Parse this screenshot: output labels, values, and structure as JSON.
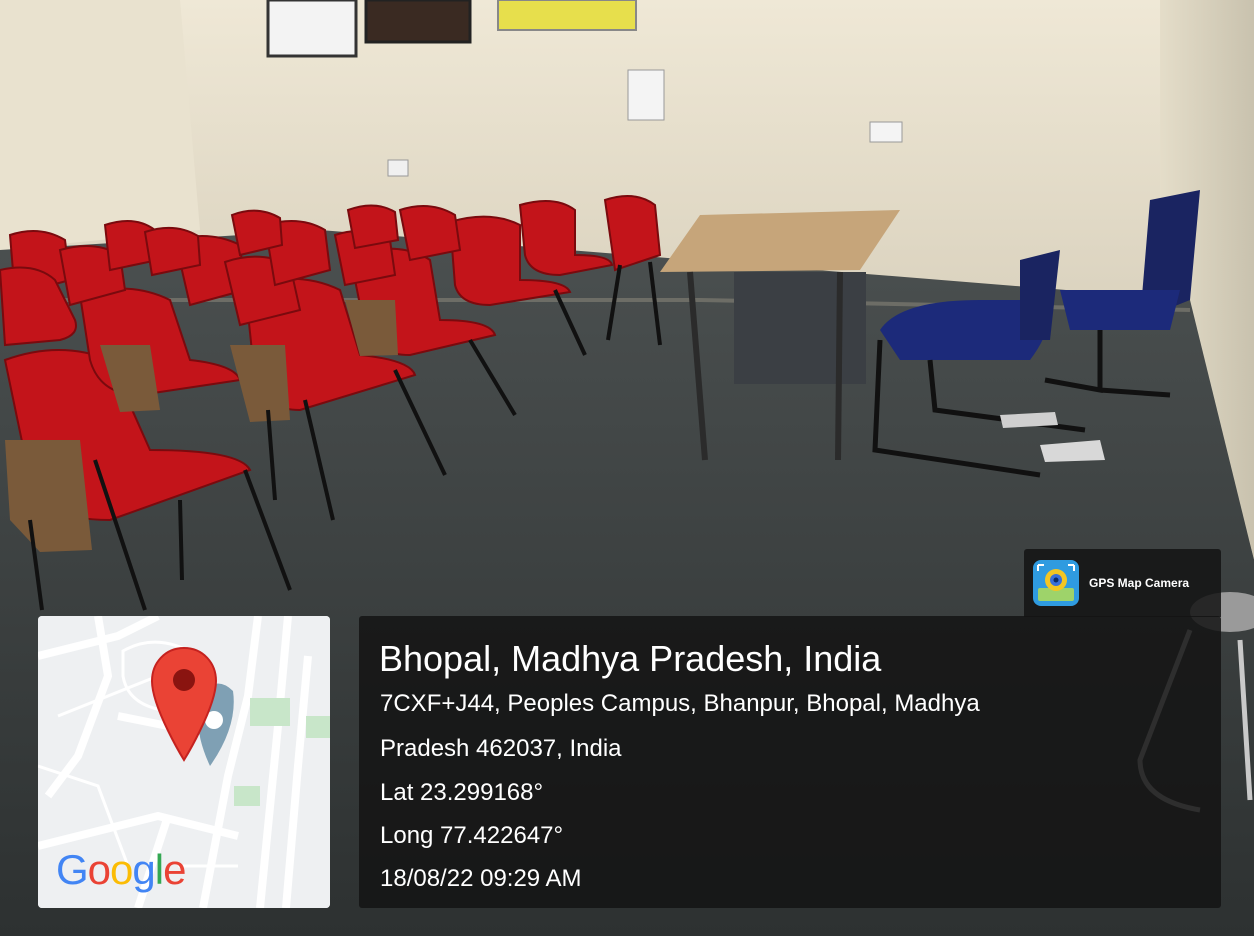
{
  "photo": {
    "description_icon": "classroom-photo"
  },
  "map": {
    "logo_text": [
      "G",
      "o",
      "o",
      "g",
      "l",
      "e"
    ],
    "logo_colors": [
      "#4285F4",
      "#EA4335",
      "#FBBC05",
      "#4285F4",
      "#34A853",
      "#EA4335"
    ],
    "pin_color": "#EA4335"
  },
  "badge": {
    "label": "GPS Map Camera",
    "icon": "gps-map-camera-icon"
  },
  "location": {
    "title": "Bhopal, Madhya Pradesh, India",
    "address_line1": "7CXF+J44, Peoples Campus, Bhanpur, Bhopal, Madhya",
    "address_line2": "Pradesh 462037, India",
    "lat": "Lat 23.299168°",
    "long": "Long 77.422647°",
    "datetime": "18/08/22 09:29 AM"
  }
}
